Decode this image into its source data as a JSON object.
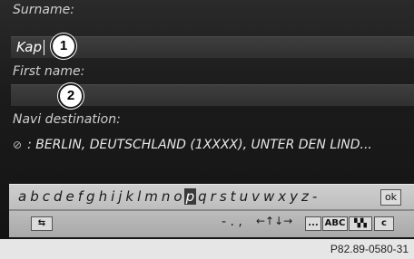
{
  "form": {
    "surname_label": "Surname:",
    "surname_value": "Kap",
    "firstname_label": "First name:",
    "firstname_value": "",
    "navi_label": "Navi destination:",
    "navi_value": ": BERLIN, DEUTSCHLAND (1XXXX), UNTER DEN LIND..."
  },
  "callouts": {
    "one": "1",
    "two": "2"
  },
  "keyboard": {
    "letters": [
      "a",
      "b",
      "c",
      "d",
      "e",
      "f",
      "g",
      "h",
      "i",
      "j",
      "k",
      "l",
      "m",
      "n",
      "o",
      "p",
      "q",
      "r",
      "s",
      "t",
      "u",
      "v",
      "w",
      "x",
      "y",
      "z"
    ],
    "selected_letter": "p",
    "trailing": "-",
    "ok_label": "ok",
    "punct": "- . ,",
    "arrows": "←↑↓→",
    "ellipsis_label": "...",
    "abc_label": "ABC",
    "c_label": "c"
  },
  "footer": {
    "ref": "P82.89-0580-31"
  }
}
